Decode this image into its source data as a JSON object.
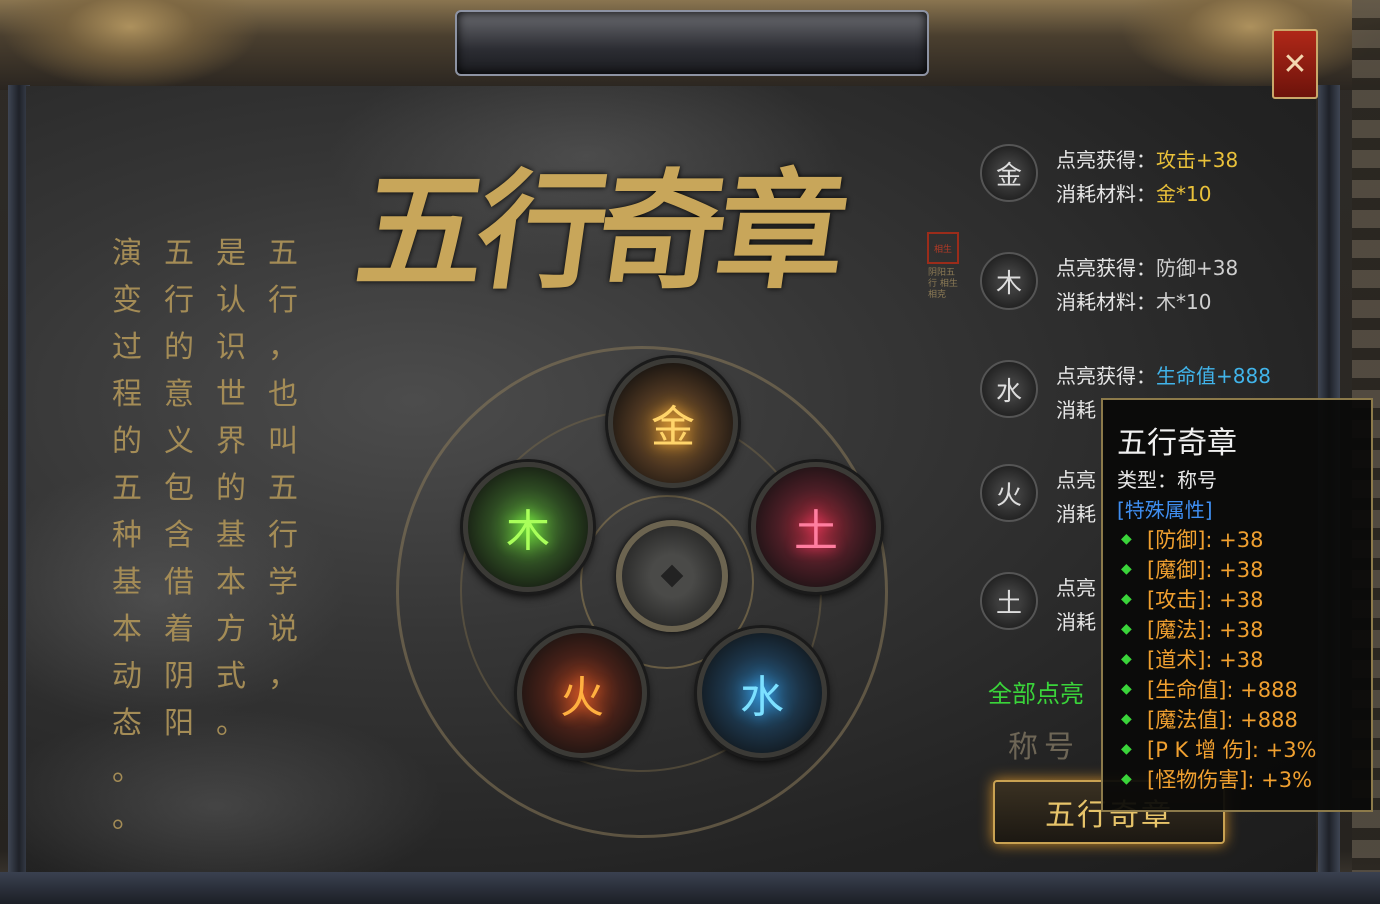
{
  "window": {
    "title": "五行奇章",
    "close_symbol": "✕",
    "seal_text": "相生",
    "side_note": "阴阳五行 相生相克"
  },
  "poem": {
    "columns": [
      "五行，也叫五行学说，",
      "是认识世界的基本方式。",
      "五行的意义包含借着阴阳",
      "演变过程的五种基本动态。。"
    ]
  },
  "elements": [
    {
      "name": "gold-orb",
      "glyph": "金",
      "color": "#ffd46a"
    },
    {
      "name": "wood-orb",
      "glyph": "木",
      "color": "#a9ff5a"
    },
    {
      "name": "water-orb",
      "glyph": "水",
      "color": "#7ce0ff"
    },
    {
      "name": "fire-orb",
      "glyph": "火",
      "color": "#ffb040"
    },
    {
      "name": "earth-orb",
      "glyph": "土",
      "color": "#ff7ea0"
    }
  ],
  "rows": [
    {
      "icon": "金",
      "gain_label": "点亮获得：",
      "gain_value": "攻击+38",
      "cost_label": "消耗材料：",
      "cost_value": "金*10",
      "color": "gold"
    },
    {
      "icon": "木",
      "gain_label": "点亮获得：",
      "gain_value": "防御+38",
      "cost_label": "消耗材料：",
      "cost_value": "木*10",
      "color": "grey"
    },
    {
      "icon": "水",
      "gain_label": "点亮获得：",
      "gain_value": "生命值+888",
      "cost_label": "消耗",
      "cost_value": "",
      "color": "blue"
    },
    {
      "icon": "火",
      "gain_label": "点亮",
      "gain_value": "",
      "cost_label": "消耗",
      "cost_value": "",
      "color": "grey"
    },
    {
      "icon": "土",
      "gain_label": "点亮",
      "gain_value": "",
      "cost_label": "消耗",
      "cost_value": "",
      "color": "grey"
    }
  ],
  "all_lit_label": "全部点亮",
  "title_label": "称号",
  "action_button": "五行奇章",
  "tooltip": {
    "title": "五行奇章",
    "type": "类型：称号",
    "section": "[特殊属性]",
    "items": [
      "[防御]: +38",
      "[魔御]: +38",
      "[攻击]: +38",
      "[魔法]: +38",
      "[道术]: +38",
      "[生命值]: +888",
      "[魔法值]: +888",
      "[P K 增 伤]: +3%",
      "[怪物伤害]: +3%"
    ]
  }
}
